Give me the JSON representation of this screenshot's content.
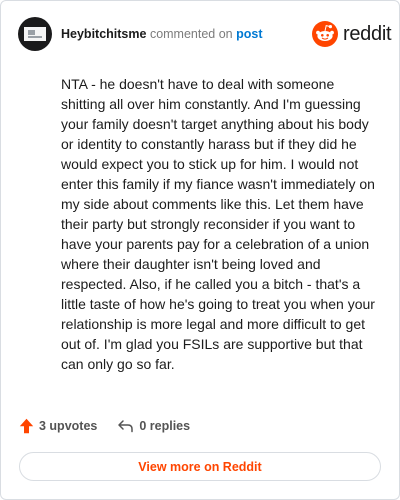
{
  "comment": {
    "author": "Heybitchitsme",
    "action_text": "commented on",
    "target_link": "post",
    "body": "NTA - he doesn't have to deal with someone shitting all over him constantly. And I'm guessing your family doesn't target anything about his body or identity to constantly harass but if they did he would expect you to stick up for him. I would not enter this family if my fiance wasn't immediately on my side about comments like this. Let them have their party but strongly reconsider if you want to have your parents pay for a celebration of a union where their daughter isn't being loved and respected. Also, if he called you a bitch - that's a little taste of how he's going to treat you when your relationship is more legal and more difficult to get out of. I'm glad you FSILs are supportive but that can only go so far."
  },
  "brand": {
    "name": "reddit",
    "icon": "reddit-snoo-icon",
    "color": "#ff4500"
  },
  "actions": {
    "upvotes": "3 upvotes",
    "upvote_icon": "upvote-arrow-icon",
    "upvote_color": "#ff4500",
    "replies": "0 replies",
    "reply_icon": "reply-arrow-icon"
  },
  "footer": {
    "view_more_label": "View more on Reddit"
  }
}
